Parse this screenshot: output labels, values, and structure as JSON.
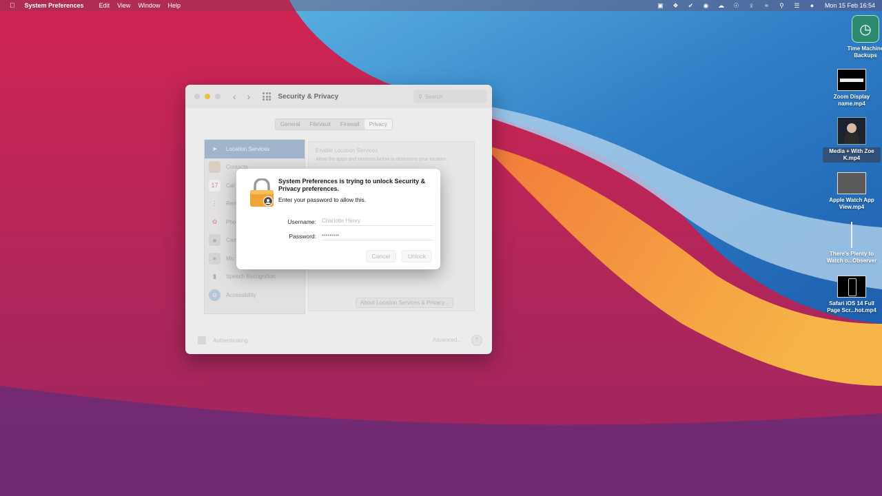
{
  "menubar": {
    "app_name": "System Preferences",
    "items": [
      "Edit",
      "View",
      "Window",
      "Help"
    ],
    "clock": "Mon 15 Feb  16:54"
  },
  "desktop_icons": [
    {
      "label": "Time Machine Backups"
    },
    {
      "label": "Zoom Display name.mp4"
    },
    {
      "label": "Media + With Zoe K.mp4"
    },
    {
      "label": "Apple Watch App View.mp4"
    },
    {
      "label": "There's Plenty to Watch o...Observer"
    },
    {
      "label": "Safari iOS 14 Full Page Scr...hot.mp4"
    }
  ],
  "window": {
    "title": "Security & Privacy",
    "search_placeholder": "Search",
    "tabs": [
      "General",
      "FileVault",
      "Firewall",
      "Privacy"
    ],
    "active_tab": "Privacy",
    "sidebar": [
      {
        "label": "Location Services",
        "icon": "location-arrow-icon"
      },
      {
        "label": "Contacts",
        "icon": "contacts-icon"
      },
      {
        "label": "Cal",
        "icon": "calendar-icon"
      },
      {
        "label": "Rem",
        "icon": "reminders-icon"
      },
      {
        "label": "Pho",
        "icon": "photos-icon"
      },
      {
        "label": "Cam",
        "icon": "camera-icon"
      },
      {
        "label": "Mic",
        "icon": "microphone-icon"
      },
      {
        "label": "Speech Recognition",
        "icon": "speech-icon"
      },
      {
        "label": "Accessibility",
        "icon": "accessibility-icon"
      }
    ],
    "enable_location": "Enable Location Services",
    "allow_text": "Allow the apps and services below to determine your location.",
    "about_button": "About Location Services & Privacy...",
    "footer_text": "Authenticating",
    "advanced_button": "Advanced...",
    "help_button": "?"
  },
  "dialog": {
    "title": "System Preferences is trying to unlock Security & Privacy preferences.",
    "subtitle": "Enter your password to allow this.",
    "username_label": "Username:",
    "username_value": "Charlotte Henry",
    "password_label": "Password:",
    "password_value": "•••••••••",
    "cancel_label": "Cancel",
    "unlock_label": "Unlock"
  }
}
